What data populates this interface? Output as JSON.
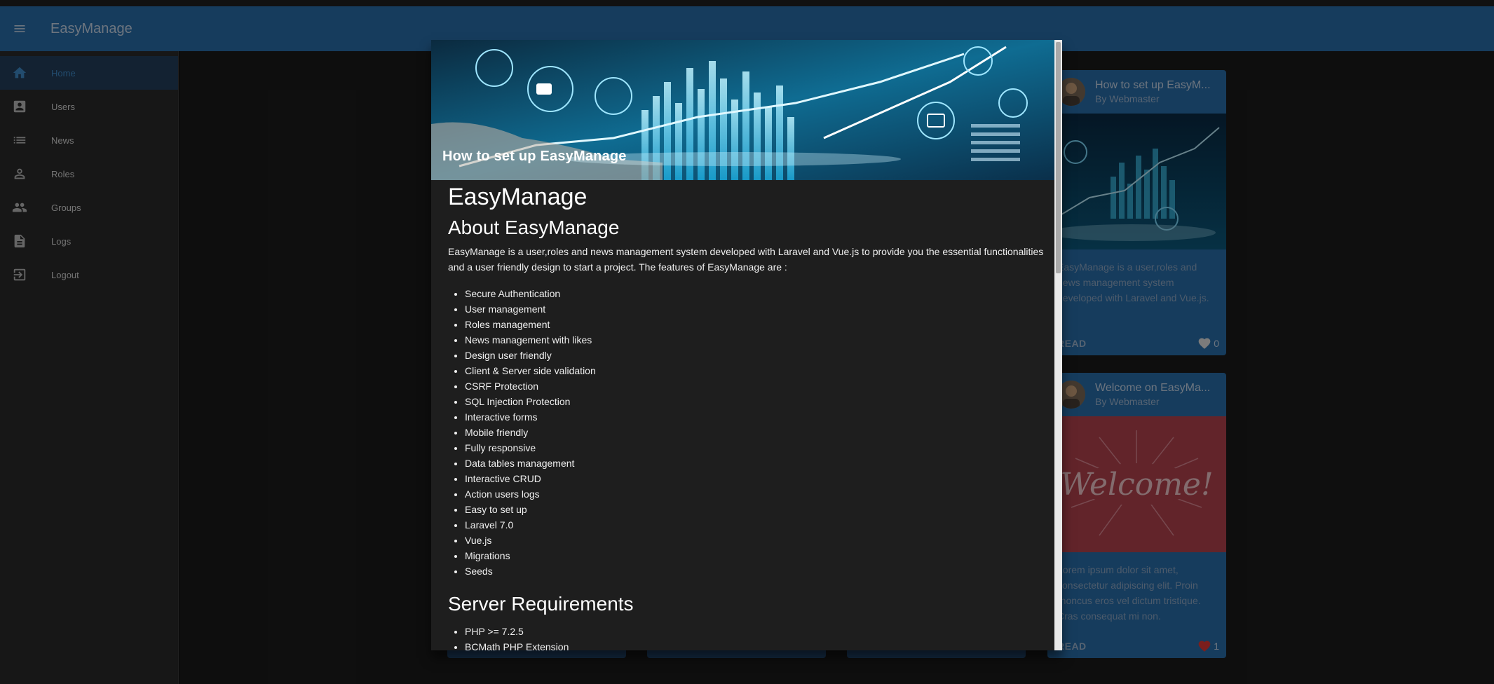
{
  "app": {
    "title": "EasyManage"
  },
  "sidebar": {
    "items": [
      {
        "label": "Home",
        "icon": "home-icon",
        "active": true
      },
      {
        "label": "Users",
        "icon": "account-box-icon"
      },
      {
        "label": "News",
        "icon": "list-icon"
      },
      {
        "label": "Roles",
        "icon": "person-icon"
      },
      {
        "label": "Groups",
        "icon": "people-icon"
      },
      {
        "label": "Logs",
        "icon": "file-document-icon"
      },
      {
        "label": "Logout",
        "icon": "exit-icon"
      }
    ]
  },
  "cards": [
    {
      "title": "How to set up EasyM...",
      "author": "By Webmaster",
      "text": "EasyManage is a user,roles and news management system developed with Laravel and Vue.js.",
      "read_label": "READ",
      "likes": "0"
    },
    {
      "title": "Welcome on EasyMa...",
      "author": "By Webmaster",
      "image_text": "Welcome!",
      "text": "Lorem ipsum dolor sit amet, consectetur adipiscing elit. Proin rhoncus eros vel dictum tristique. Cras consequat mi non.",
      "read_label": "READ",
      "likes": "1"
    }
  ],
  "dialog": {
    "image_title": "How to set up EasyManage",
    "doc_title": "EasyManage",
    "about_heading": "About EasyManage",
    "intro": "EasyManage is a user,roles and news management system developed with Laravel and Vue.js to provide you the essential functionalities and a user friendly design to start a project. The features of EasyManage are :",
    "features": [
      "Secure Authentication",
      "User management",
      "Roles management",
      "News management with likes",
      "Design user friendly",
      "Client & Server side validation",
      "CSRF Protection",
      "SQL Injection Protection",
      "Interactive forms",
      "Mobile friendly",
      "Fully responsive",
      "Data tables management",
      "Interactive CRUD",
      "Action users logs",
      "Easy to set up",
      "Laravel 7.0",
      "Vue.js",
      "Migrations",
      "Seeds"
    ],
    "req_heading": "Server Requirements",
    "requirements": [
      "PHP >= 7.2.5",
      "BCMath PHP Extension"
    ]
  },
  "colors": {
    "appbar": "#2a6fad",
    "active_item": "#3f8ccc",
    "card": "#2a6fad",
    "heart_filled": "#e53935"
  }
}
